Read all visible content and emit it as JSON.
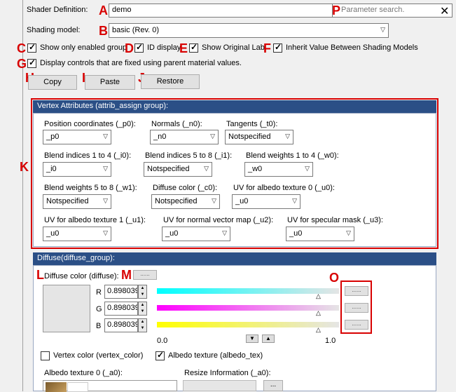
{
  "markers": [
    "A",
    "B",
    "C",
    "D",
    "E",
    "F",
    "G",
    "H",
    "I",
    "J",
    "K",
    "L",
    "M",
    "O",
    "P"
  ],
  "shader_definition": {
    "label": "Shader Definition:",
    "value": "demo",
    "search_placeholder": "Parameter search."
  },
  "shading_model": {
    "label": "Shading model:",
    "value": "basic (Rev. 0)"
  },
  "options": {
    "show_only_enabled": "Show only enabled group",
    "id_display": "ID display",
    "show_original_label": "Show Original Label",
    "inherit_value": "Inherit Value Between Shading Models",
    "display_fixed": "Display controls that are fixed using parent material values."
  },
  "buttons": {
    "copy": "Copy",
    "paste": "Paste",
    "restore": "Restore"
  },
  "vertex_group": {
    "title": "Vertex Attributes (attrib_assign group):",
    "fields": [
      {
        "label": "Position coordinates (_p0):",
        "value": "_p0"
      },
      {
        "label": "Normals (_n0):",
        "value": "_n0"
      },
      {
        "label": "Tangents (_t0):",
        "value": "Notspecified"
      },
      {
        "label": "Blend indices 1 to 4 (_i0):",
        "value": "_i0"
      },
      {
        "label": "Blend indices 5 to 8 (_i1):",
        "value": "Notspecified"
      },
      {
        "label": "Blend weights 1 to 4 (_w0):",
        "value": "_w0"
      },
      {
        "label": "Blend weights 5 to 8 (_w1):",
        "value": "Notspecified"
      },
      {
        "label": "Diffuse color (_c0):",
        "value": "Notspecified"
      },
      {
        "label": "UV for albedo texture 0 (_u0):",
        "value": "_u0"
      },
      {
        "label": "UV for albedo texture 1 (_u1):",
        "value": "_u0"
      },
      {
        "label": "UV for normal vector map (_u2):",
        "value": "_u0"
      },
      {
        "label": "UV for specular mask (_u3):",
        "value": "_u0"
      }
    ]
  },
  "diffuse_group": {
    "title": "Diffuse(diffuse_group):",
    "color_label": "Diffuse color (diffuse):",
    "channels": [
      {
        "name": "R",
        "value": "0.898039"
      },
      {
        "name": "G",
        "value": "0.898039"
      },
      {
        "name": "B",
        "value": "0.898039"
      }
    ],
    "range_min": "0.0",
    "range_max": "1.0",
    "vertex_color": "Vertex color (vertex_color)",
    "albedo_texture": "Albedo texture (albedo_tex)",
    "albedo_tex0": "Albedo texture 0 (_a0):",
    "resize_info": "Resize Information (_a0):",
    "dots": "......"
  },
  "colors": {
    "accent": "#2b4f86",
    "marker": "#d80000"
  }
}
